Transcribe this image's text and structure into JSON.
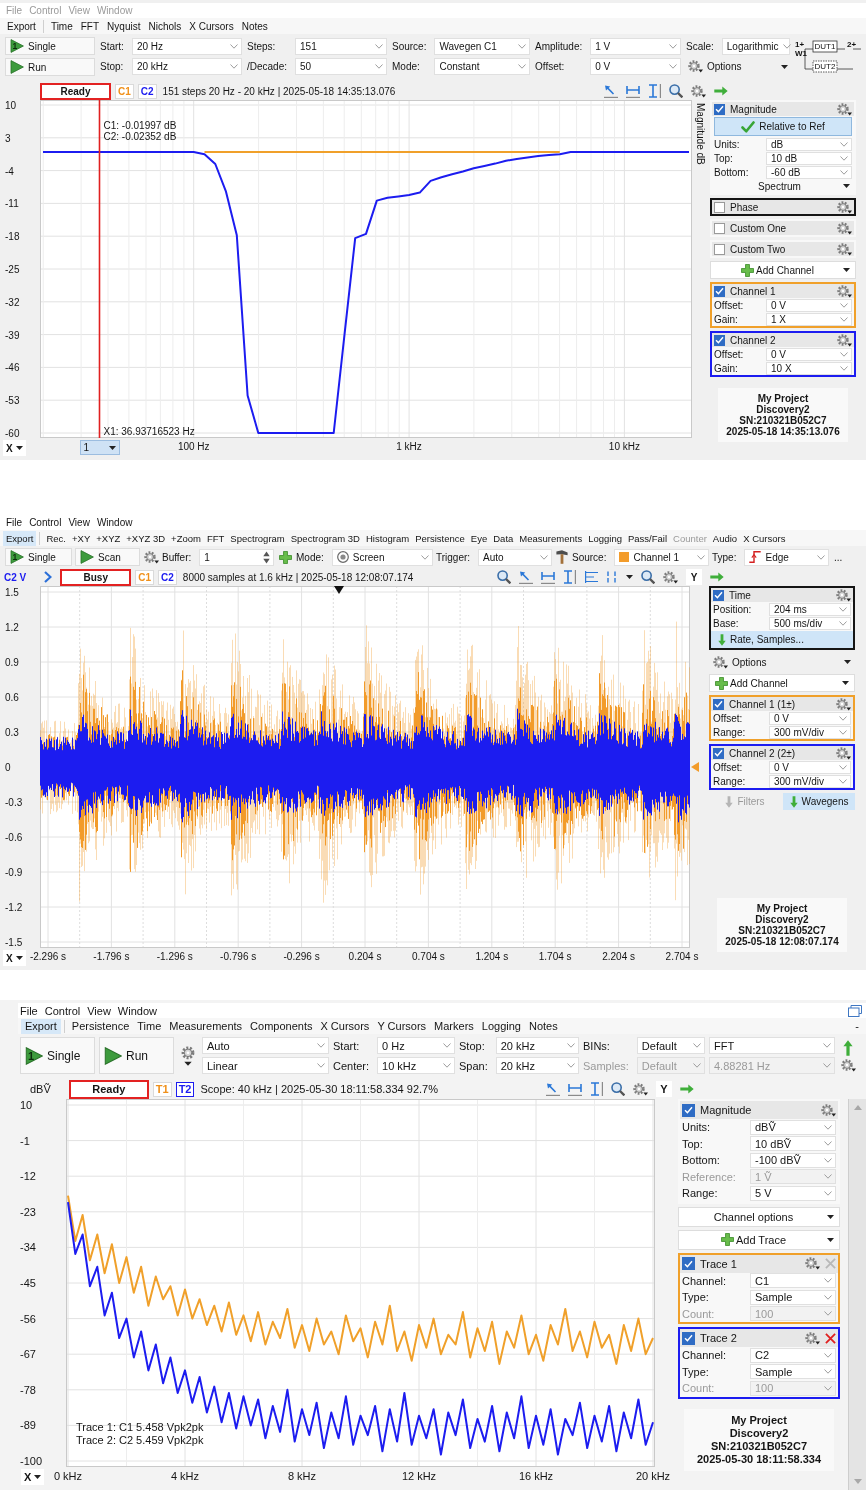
{
  "panels": [
    {
      "menu": [
        {
          "label": "File",
          "disabled": true
        },
        {
          "label": "Control",
          "disabled": true
        },
        {
          "label": "View",
          "disabled": true
        },
        {
          "label": "Window",
          "disabled": true
        }
      ],
      "toolbar": [
        {
          "label": "Export",
          "selected": false,
          "disabled": false
        },
        {
          "label": "Time",
          "selected": false,
          "disabled": false
        },
        {
          "label": "FFT",
          "selected": false,
          "disabled": false
        },
        {
          "label": "Nyquist",
          "selected": false,
          "disabled": false
        },
        {
          "label": "Nichols",
          "selected": false,
          "disabled": false
        },
        {
          "label": "X Cursors",
          "selected": false,
          "disabled": false
        },
        {
          "label": "Notes",
          "selected": false,
          "disabled": false
        }
      ],
      "controls": [
        {
          "rows": [
            {
              "kind": "button",
              "label": "Single",
              "badge": "1"
            },
            {
              "kind": "button",
              "label": "Run"
            }
          ]
        },
        {
          "rows": [
            {
              "kind": "field",
              "label": "Start:",
              "value": "20 Hz",
              "disabled": false
            },
            {
              "kind": "field",
              "label": "Stop:",
              "value": "20 kHz",
              "disabled": false
            }
          ]
        },
        {
          "rows": [
            {
              "kind": "field",
              "label": "Steps:",
              "value": "151",
              "disabled": false
            },
            {
              "kind": "field",
              "label": "/Decade:",
              "value": "50",
              "disabled": false
            }
          ]
        },
        {
          "rows": [
            {
              "kind": "field",
              "label": "Source:",
              "value": "Wavegen C1",
              "disabled": false
            },
            {
              "kind": "field",
              "label": "Mode:",
              "value": "Constant",
              "disabled": false
            }
          ]
        },
        {
          "rows": [
            {
              "kind": "field",
              "label": "Amplitude:",
              "value": "1 V",
              "disabled": false
            },
            {
              "kind": "field",
              "label": "Offset:",
              "value": "0 V",
              "disabled": false
            }
          ]
        },
        {
          "rows": [
            {
              "kind": "field",
              "label": "Scale:",
              "value": "Logarithmic",
              "disabled": false
            },
            {
              "kind": "options",
              "label": "Options"
            }
          ]
        },
        {
          "rows": [
            {
              "kind": "diagram",
              "labels": [
                "1+",
                "W1",
                "DUT1",
                "2+",
                "DUT2"
              ]
            }
          ]
        }
      ],
      "status": {
        "state": "Ready",
        "channels": [
          {
            "label": "C1",
            "color": "#f0901a",
            "selected": false
          },
          {
            "label": "C2",
            "color": "#1c1cf0",
            "selected": false
          }
        ],
        "info": "151 steps 20 Hz - 20 kHz | 2025-05-18 14:35:13.076",
        "tools": [
          {
            "kind": "cursor"
          },
          {
            "kind": "hcursor"
          },
          {
            "kind": "vcursor"
          },
          {
            "kind": "zoom"
          },
          {
            "kind": "gear"
          },
          {
            "kind": "next"
          }
        ]
      },
      "plot": {
        "kind": "chart",
        "x_button": "X",
        "cursor": {
          "select": "1",
          "readouts": [
            "C1: -0.01997 dB",
            "C2: -0.02352 dB"
          ]
        },
        "chart_data": {
          "type": "line",
          "grid": true,
          "ylabel": "Magnitude dB",
          "ylim": [
            -60,
            10
          ],
          "yticks": [
            10,
            3,
            -4,
            -11,
            -18,
            -25,
            -32,
            -39,
            -46,
            -53,
            -60
          ],
          "categories": [
            null,
            null,
            null,
            null,
            null,
            null,
            null,
            null,
            null,
            null,
            null,
            null,
            null,
            null,
            "100 Hz",
            null,
            null,
            null,
            null,
            null,
            null,
            null,
            null,
            null,
            null,
            null,
            null,
            null,
            null,
            null,
            null,
            null,
            null,
            null,
            "1 kHz",
            null,
            null,
            null,
            null,
            null,
            null,
            null,
            null,
            null,
            null,
            null,
            null,
            null,
            null,
            null,
            null,
            null,
            null,
            null,
            "10 kHz",
            null,
            null,
            null,
            null,
            null,
            null
          ],
          "series": [
            {
              "color": "#f0a02a",
              "values": [
                null,
                null,
                null,
                null,
                null,
                null,
                null,
                null,
                null,
                null,
                null,
                null,
                null,
                null,
                null,
                0,
                0,
                0,
                0,
                0,
                0,
                0,
                0,
                0,
                0,
                0,
                0,
                0,
                0,
                0,
                0,
                0,
                0,
                0,
                0,
                0,
                0,
                0,
                0,
                0,
                0,
                0,
                0,
                0,
                0,
                0,
                0,
                0,
                0,
                null,
                null,
                null,
                null,
                null,
                null,
                null,
                null,
                null,
                null,
                null,
                null
              ]
            },
            {
              "color": "#1c1cf0",
              "values": [
                0,
                0,
                0,
                0,
                0,
                0,
                0,
                0,
                0,
                0,
                0,
                0,
                0,
                0,
                0,
                -0.5,
                -2.6,
                -8.5,
                -17.8,
                -52,
                -60,
                -60,
                -60,
                -60,
                -60,
                -60,
                -60,
                -60,
                -39,
                -18.4,
                -17.5,
                -10.4,
                -9.8,
                -9.5,
                -9.2,
                -8.7,
                -6.2,
                -5.4,
                -4.8,
                -4.2,
                -3.5,
                -3.0,
                -2.5,
                -1.9,
                -1.5,
                -1.2,
                -0.9,
                -0.7,
                -0.5,
                0,
                0,
                0,
                0,
                0,
                0,
                0,
                0,
                0,
                0,
                0,
                0
              ]
            }
          ],
          "annotations": [
            "X1: 36.93716523 Hz"
          ]
        }
      },
      "sidebar": [
        {
          "kind": "channel",
          "title": "Magnitude",
          "checked": true,
          "selected": false,
          "rows": [
            {
              "kind": "checkbutton",
              "label": "Relative to Ref"
            },
            {
              "kind": "field",
              "label": "Units:",
              "value": "dB",
              "disabled": false
            },
            {
              "kind": "field",
              "label": "Top:",
              "value": "10 dB",
              "disabled": false
            },
            {
              "kind": "field",
              "label": "Bottom:",
              "value": "-60 dB",
              "disabled": false
            },
            {
              "kind": "dropdown",
              "label": "Spectrum"
            }
          ]
        },
        {
          "kind": "channel",
          "title": "Phase",
          "checked": false,
          "selected": true
        },
        {
          "kind": "channel",
          "title": "Custom One",
          "checked": false,
          "selected": false
        },
        {
          "kind": "channel",
          "title": "Custom Two",
          "checked": false,
          "selected": false
        },
        {
          "kind": "add",
          "label": "Add Channel"
        },
        {
          "kind": "channel",
          "title": "Channel 1",
          "checked": true,
          "selected": false,
          "color": "#f0a02a",
          "rows": [
            {
              "kind": "field",
              "label": "Offset:",
              "value": "0 V",
              "disabled": false
            },
            {
              "kind": "field",
              "label": "Gain:",
              "value": "1 X",
              "disabled": false
            }
          ]
        },
        {
          "kind": "channel",
          "title": "Channel 2",
          "checked": true,
          "selected": false,
          "color": "#1c1cf0",
          "rows": [
            {
              "kind": "field",
              "label": "Offset:",
              "value": "0 V",
              "disabled": false
            },
            {
              "kind": "field",
              "label": "Gain:",
              "value": "10 X",
              "disabled": false
            }
          ]
        }
      ],
      "device": [
        "My Project",
        "Discovery2",
        "SN:210321B052C7",
        "2025-05-18 14:35:13.076"
      ]
    },
    {
      "menu": [
        {
          "label": "File",
          "disabled": false
        },
        {
          "label": "Control",
          "disabled": false
        },
        {
          "label": "View",
          "disabled": false
        },
        {
          "label": "Window",
          "disabled": false
        }
      ],
      "toolbar": [
        {
          "label": "Export",
          "selected": true,
          "disabled": false
        },
        {
          "label": "Rec.",
          "selected": false,
          "disabled": false
        },
        {
          "label": "+XY",
          "selected": false,
          "disabled": false
        },
        {
          "label": "+XYZ",
          "selected": false,
          "disabled": false
        },
        {
          "label": "+XYZ 3D",
          "selected": false,
          "disabled": false
        },
        {
          "label": "+Zoom",
          "selected": false,
          "disabled": false
        },
        {
          "label": "FFT",
          "selected": false,
          "disabled": false
        },
        {
          "label": "Spectrogram",
          "selected": false,
          "disabled": false
        },
        {
          "label": "Spectrogram 3D",
          "selected": false,
          "disabled": false
        },
        {
          "label": "Histogram",
          "selected": false,
          "disabled": false
        },
        {
          "label": "Persistence",
          "selected": false,
          "disabled": false
        },
        {
          "label": "Eye",
          "selected": false,
          "disabled": false
        },
        {
          "label": "Data",
          "selected": false,
          "disabled": false
        },
        {
          "label": "Measurements",
          "selected": false,
          "disabled": false
        },
        {
          "label": "Logging",
          "selected": false,
          "disabled": false
        },
        {
          "label": "Pass/Fail",
          "selected": false,
          "disabled": false
        },
        {
          "label": "Counter",
          "selected": false,
          "disabled": true
        },
        {
          "label": "Audio",
          "selected": false,
          "disabled": false
        },
        {
          "label": "X Cursors",
          "selected": false,
          "disabled": false
        }
      ],
      "controls": [
        {
          "rows": [
            {
              "kind": "button",
              "label": "Single",
              "badge": "1"
            }
          ]
        },
        {
          "rows": [
            {
              "kind": "button",
              "label": "Scan"
            }
          ]
        },
        {
          "rows": [
            {
              "kind": "gear"
            }
          ]
        },
        {
          "rows": [
            {
              "kind": "spin",
              "label": "Buffer:",
              "value": "1",
              "disabled": false
            }
          ]
        },
        {
          "rows": [
            {
              "kind": "plus"
            }
          ]
        },
        {
          "rows": [
            {
              "kind": "ring",
              "label": "Mode:",
              "value": "Screen",
              "disabled": false
            }
          ]
        },
        {
          "rows": [
            {
              "kind": "field",
              "label": "Trigger:",
              "value": "Auto",
              "disabled": false
            }
          ]
        },
        {
          "rows": [
            {
              "kind": "hammer"
            }
          ]
        },
        {
          "rows": [
            {
              "kind": "swatch",
              "label": "Source:",
              "value": "Channel 1",
              "color": "#f39c2b",
              "disabled": false
            }
          ]
        },
        {
          "rows": [
            {
              "kind": "edge",
              "label": "Type:",
              "value": "Edge",
              "disabled": false
            }
          ]
        },
        {
          "rows": [
            {
              "kind": "more",
              "label": "..."
            }
          ]
        }
      ],
      "status": {
        "lead": [
          {
            "kind": "unit",
            "label": "C2 V",
            "color": "#1c1cf0"
          },
          {
            "kind": "chevron"
          }
        ],
        "state": "Busy",
        "channels": [
          {
            "label": "C1",
            "color": "#f0901a",
            "selected": false
          },
          {
            "label": "C2",
            "color": "#1c1cf0",
            "selected": false
          }
        ],
        "info": "8000 samples at 1.6 kHz | 2025-05-18 12:08:07.174",
        "tools": [
          {
            "kind": "zoom"
          },
          {
            "kind": "cursor"
          },
          {
            "kind": "hcursor"
          },
          {
            "kind": "vcursor"
          },
          {
            "kind": "lines"
          },
          {
            "kind": "digits"
          },
          {
            "kind": "caret"
          },
          {
            "kind": "zoom"
          },
          {
            "kind": "gear"
          },
          {
            "kind": "text",
            "label": "Y"
          },
          {
            "kind": "next"
          }
        ]
      },
      "plot": {
        "kind": "waveform",
        "x_button": "X",
        "yticks": [
          "1.5",
          "1.2",
          "0.9",
          "0.6",
          "0.3",
          "0",
          "-0.3",
          "-0.6",
          "-0.9",
          "-1.2",
          "-1.5"
        ],
        "xticks": [
          "-2.296 s",
          "-1.796 s",
          "-1.296 s",
          "-0.796 s",
          "-0.296 s",
          "0.204 s",
          "0.704 s",
          "1.204 s",
          "1.704 s",
          "2.204 s",
          "2.704 s"
        ],
        "series": [
          {
            "color": "#f29b2a"
          },
          {
            "color": "#1c1cf0"
          }
        ]
      },
      "sidebar": [
        {
          "kind": "channel",
          "title": "Time",
          "checked": true,
          "selected": true,
          "rows": [
            {
              "kind": "field",
              "label": "Position:",
              "value": "204 ms",
              "disabled": false
            },
            {
              "kind": "field",
              "label": "Base:",
              "value": "500 ms/div",
              "disabled": false
            },
            {
              "kind": "expander",
              "label": "Rate, Samples..."
            }
          ]
        },
        {
          "kind": "settings",
          "label": "Options"
        },
        {
          "kind": "add",
          "label": "Add Channel"
        },
        {
          "kind": "channel",
          "title": "Channel 1 (1±)",
          "checked": true,
          "selected": false,
          "color": "#f0a02a",
          "rows": [
            {
              "kind": "field",
              "label": "Offset:",
              "value": "0 V",
              "disabled": false
            },
            {
              "kind": "field",
              "label": "Range:",
              "value": "300 mV/div",
              "disabled": false
            }
          ]
        },
        {
          "kind": "channel",
          "title": "Channel 2 (2±)",
          "checked": true,
          "selected": false,
          "color": "#1c1cf0",
          "rows": [
            {
              "kind": "field",
              "label": "Offset:",
              "value": "0 V",
              "disabled": false
            },
            {
              "kind": "field",
              "label": "Range:",
              "value": "300 mV/div",
              "disabled": false
            }
          ]
        },
        {
          "kind": "tabs",
          "items": [
            {
              "label": "Filters",
              "selected": false,
              "disabled": true
            },
            {
              "label": "Wavegens",
              "selected": true,
              "disabled": false
            }
          ]
        }
      ],
      "device": [
        "My Project",
        "Discovery2",
        "SN:210321B052C7",
        "2025-05-18 12:08:07.174"
      ]
    },
    {
      "menu": [
        {
          "label": "File",
          "disabled": false
        },
        {
          "label": "Control",
          "disabled": false
        },
        {
          "label": "View",
          "disabled": false
        },
        {
          "label": "Window",
          "disabled": false
        }
      ],
      "toolbar": [
        {
          "label": "Export",
          "selected": true,
          "disabled": false
        },
        {
          "label": "Persistence",
          "selected": false,
          "disabled": false
        },
        {
          "label": "Time",
          "selected": false,
          "disabled": false
        },
        {
          "label": "Measurements",
          "selected": false,
          "disabled": false
        },
        {
          "label": "Components",
          "selected": false,
          "disabled": false
        },
        {
          "label": "X Cursors",
          "selected": false,
          "disabled": false
        },
        {
          "label": "Y Cursors",
          "selected": false,
          "disabled": false
        },
        {
          "label": "Markers",
          "selected": false,
          "disabled": false
        },
        {
          "label": "Logging",
          "selected": false,
          "disabled": false
        },
        {
          "label": "Notes",
          "selected": false,
          "disabled": false
        }
      ],
      "toolbar_trailing": "-",
      "controls": [
        {
          "rows": [
            {
              "kind": "button",
              "label": "Single",
              "badge": "1"
            }
          ]
        },
        {
          "rows": [
            {
              "kind": "button",
              "label": "Run"
            }
          ]
        },
        {
          "rows": [
            {
              "kind": "menu"
            }
          ]
        },
        {
          "rows": [
            {
              "kind": "field",
              "value": "Auto",
              "disabled": false
            },
            {
              "kind": "field",
              "value": "Linear",
              "disabled": false
            }
          ]
        },
        {
          "rows": [
            {
              "kind": "field",
              "label": "Start:",
              "value": "0 Hz",
              "disabled": false
            },
            {
              "kind": "field",
              "label": "Center:",
              "value": "10 kHz",
              "disabled": false
            }
          ]
        },
        {
          "rows": [
            {
              "kind": "field",
              "label": "Stop:",
              "value": "20 kHz",
              "disabled": false
            },
            {
              "kind": "field",
              "label": "Span:",
              "value": "20 kHz",
              "disabled": false
            }
          ]
        },
        {
          "rows": [
            {
              "kind": "field",
              "label": "BINs:",
              "value": "Default",
              "disabled": false
            },
            {
              "kind": "field",
              "label": "Samples:",
              "value": "Default",
              "disabled": true
            }
          ]
        },
        {
          "rows": [
            {
              "kind": "field",
              "value": "FFT",
              "disabled": false
            },
            {
              "kind": "field",
              "value": "4.88281 Hz",
              "disabled": true
            }
          ]
        },
        {
          "rows": [
            {
              "kind": "arrow"
            },
            {
              "kind": "gear"
            }
          ]
        }
      ],
      "status": {
        "lead": [
          {
            "kind": "unit",
            "label": "dBṼ"
          }
        ],
        "state": "Ready",
        "channels": [
          {
            "label": "T1",
            "color": "#f0901a",
            "selected": false
          },
          {
            "label": "T2",
            "color": "#1c1cf0",
            "selected": true
          }
        ],
        "info": "Scope: 40 kHz | 2025-05-30 18:11:58.334 92.7%",
        "tools": [
          {
            "kind": "cursor"
          },
          {
            "kind": "hcursor"
          },
          {
            "kind": "vcursor"
          },
          {
            "kind": "zoom"
          },
          {
            "kind": "gear"
          },
          {
            "kind": "text",
            "label": "Y"
          },
          {
            "kind": "next"
          }
        ]
      },
      "plot": {
        "kind": "chart",
        "x_button": "X",
        "legend": [
          "Trace 1: C1 5.458 Vpk2pk",
          "Trace 2: C2 5.459 Vpk2pk"
        ],
        "chart_data": {
          "type": "line",
          "grid": true,
          "xlim": [
            0,
            20
          ],
          "ylim": [
            -100,
            10
          ],
          "xticks": [
            {
              "value": 0,
              "label": "0 kHz"
            },
            {
              "value": 4,
              "label": "4 kHz"
            },
            {
              "value": 8,
              "label": "8 kHz"
            },
            {
              "value": 12,
              "label": "12 kHz"
            },
            {
              "value": 16,
              "label": "16 kHz"
            },
            {
              "value": 20,
              "label": "20 kHz"
            }
          ],
          "yticks": [
            10,
            -1,
            -12,
            -23,
            -34,
            -45,
            -56,
            -67,
            -78,
            -89,
            -100
          ],
          "x": [
            0,
            0.25,
            0.5,
            0.75,
            1,
            1.25,
            1.5,
            1.75,
            2,
            2.25,
            2.5,
            2.75,
            3,
            3.25,
            3.5,
            3.75,
            4,
            4.25,
            4.5,
            4.75,
            5,
            5.25,
            5.5,
            5.75,
            6,
            6.25,
            6.5,
            6.75,
            7,
            7.25,
            7.5,
            7.75,
            8,
            8.25,
            8.5,
            8.75,
            9,
            9.25,
            9.5,
            9.75,
            10,
            10.25,
            10.5,
            10.75,
            11,
            11.25,
            11.5,
            11.75,
            12,
            12.25,
            12.5,
            12.75,
            13,
            13.25,
            13.5,
            13.75,
            14,
            14.25,
            14.5,
            14.75,
            15,
            15.25,
            15.5,
            15.75,
            16,
            16.25,
            16.5,
            16.75,
            17,
            17.25,
            17.5,
            17.75,
            18,
            18.25,
            18.5,
            18.75,
            19,
            19.25,
            19.5,
            19.75,
            20
          ],
          "series": [
            {
              "color": "#f0a02a",
              "values": [
                -18,
                -32,
                -24,
                -38,
                -30,
                -42,
                -33,
                -45,
                -37,
                -48,
                -40,
                -52,
                -43,
                -50,
                -46,
                -55,
                -47,
                -56,
                -50,
                -58,
                -52,
                -60,
                -51,
                -61,
                -55,
                -63,
                -54,
                -64,
                -57,
                -62,
                -53,
                -65,
                -58,
                -66,
                -56,
                -64,
                -60,
                -67,
                -55,
                -63,
                -59,
                -68,
                -57,
                -64,
                -52,
                -66,
                -60,
                -69,
                -58,
                -65,
                -56,
                -67,
                -61,
                -64,
                -54,
                -68,
                -59,
                -66,
                -57,
                -70,
                -60,
                -65,
                -55,
                -67,
                -61,
                -69,
                -58,
                -64,
                -53,
                -66,
                -60,
                -68,
                -57,
                -65,
                -61,
                -70,
                -58,
                -66,
                -56,
                -67,
                -62
              ]
            },
            {
              "color": "#1c1cf0",
              "values": [
                -20,
                -36,
                -30,
                -46,
                -40,
                -55,
                -48,
                -62,
                -56,
                -68,
                -60,
                -72,
                -64,
                -76,
                -68,
                -79,
                -72,
                -82,
                -74,
                -85,
                -77,
                -88,
                -79,
                -90,
                -80,
                -89,
                -81,
                -93,
                -83,
                -91,
                -78,
                -94,
                -84,
                -92,
                -82,
                -96,
                -85,
                -93,
                -80,
                -95,
                -86,
                -92,
                -83,
                -97,
                -84,
                -94,
                -79,
                -95,
                -86,
                -93,
                -84,
                -98,
                -85,
                -92,
                -81,
                -96,
                -87,
                -94,
                -83,
                -97,
                -85,
                -93,
                -80,
                -96,
                -86,
                -95,
                -84,
                -98,
                -87,
                -92,
                -82,
                -96,
                -86,
                -94,
                -83,
                -97,
                -85,
                -93,
                -81,
                -95,
                -88
              ]
            }
          ]
        }
      },
      "sidebar": [
        {
          "kind": "channel",
          "title": "Magnitude",
          "checked": true,
          "selected": false,
          "rows": [
            {
              "kind": "field",
              "label": "Units:",
              "value": "dBṼ",
              "disabled": false
            },
            {
              "kind": "field",
              "label": "Top:",
              "value": "10 dBṼ",
              "disabled": false
            },
            {
              "kind": "field",
              "label": "Bottom:",
              "value": "-100 dBṼ",
              "disabled": false
            },
            {
              "kind": "field",
              "label": "Reference:",
              "value": "1 Ṽ",
              "disabled": true
            },
            {
              "kind": "field",
              "label": "Range:",
              "value": "5 V",
              "disabled": false
            }
          ]
        },
        {
          "kind": "menu",
          "label": "Channel options"
        },
        {
          "kind": "add",
          "label": "Add Trace"
        },
        {
          "kind": "channel",
          "title": "Trace 1",
          "checked": true,
          "selected": false,
          "color": "#f0a02a",
          "close": {
            "disabled": true
          },
          "rows": [
            {
              "kind": "field",
              "label": "Channel:",
              "value": "C1",
              "disabled": false
            },
            {
              "kind": "field",
              "label": "Type:",
              "value": "Sample",
              "disabled": false
            },
            {
              "kind": "field",
              "label": "Count:",
              "value": "100",
              "disabled": true
            }
          ]
        },
        {
          "kind": "channel",
          "title": "Trace 2",
          "checked": true,
          "selected": false,
          "color": "#1c1cf0",
          "close": {
            "disabled": false
          },
          "rows": [
            {
              "kind": "field",
              "label": "Channel:",
              "value": "C2",
              "disabled": false
            },
            {
              "kind": "field",
              "label": "Type:",
              "value": "Sample",
              "disabled": false
            },
            {
              "kind": "field",
              "label": "Count:",
              "value": "100",
              "disabled": true
            }
          ]
        }
      ],
      "device": [
        "My Project",
        "Discovery2",
        "SN:210321B052C7",
        "2025-05-30 18:11:58.334"
      ]
    }
  ]
}
